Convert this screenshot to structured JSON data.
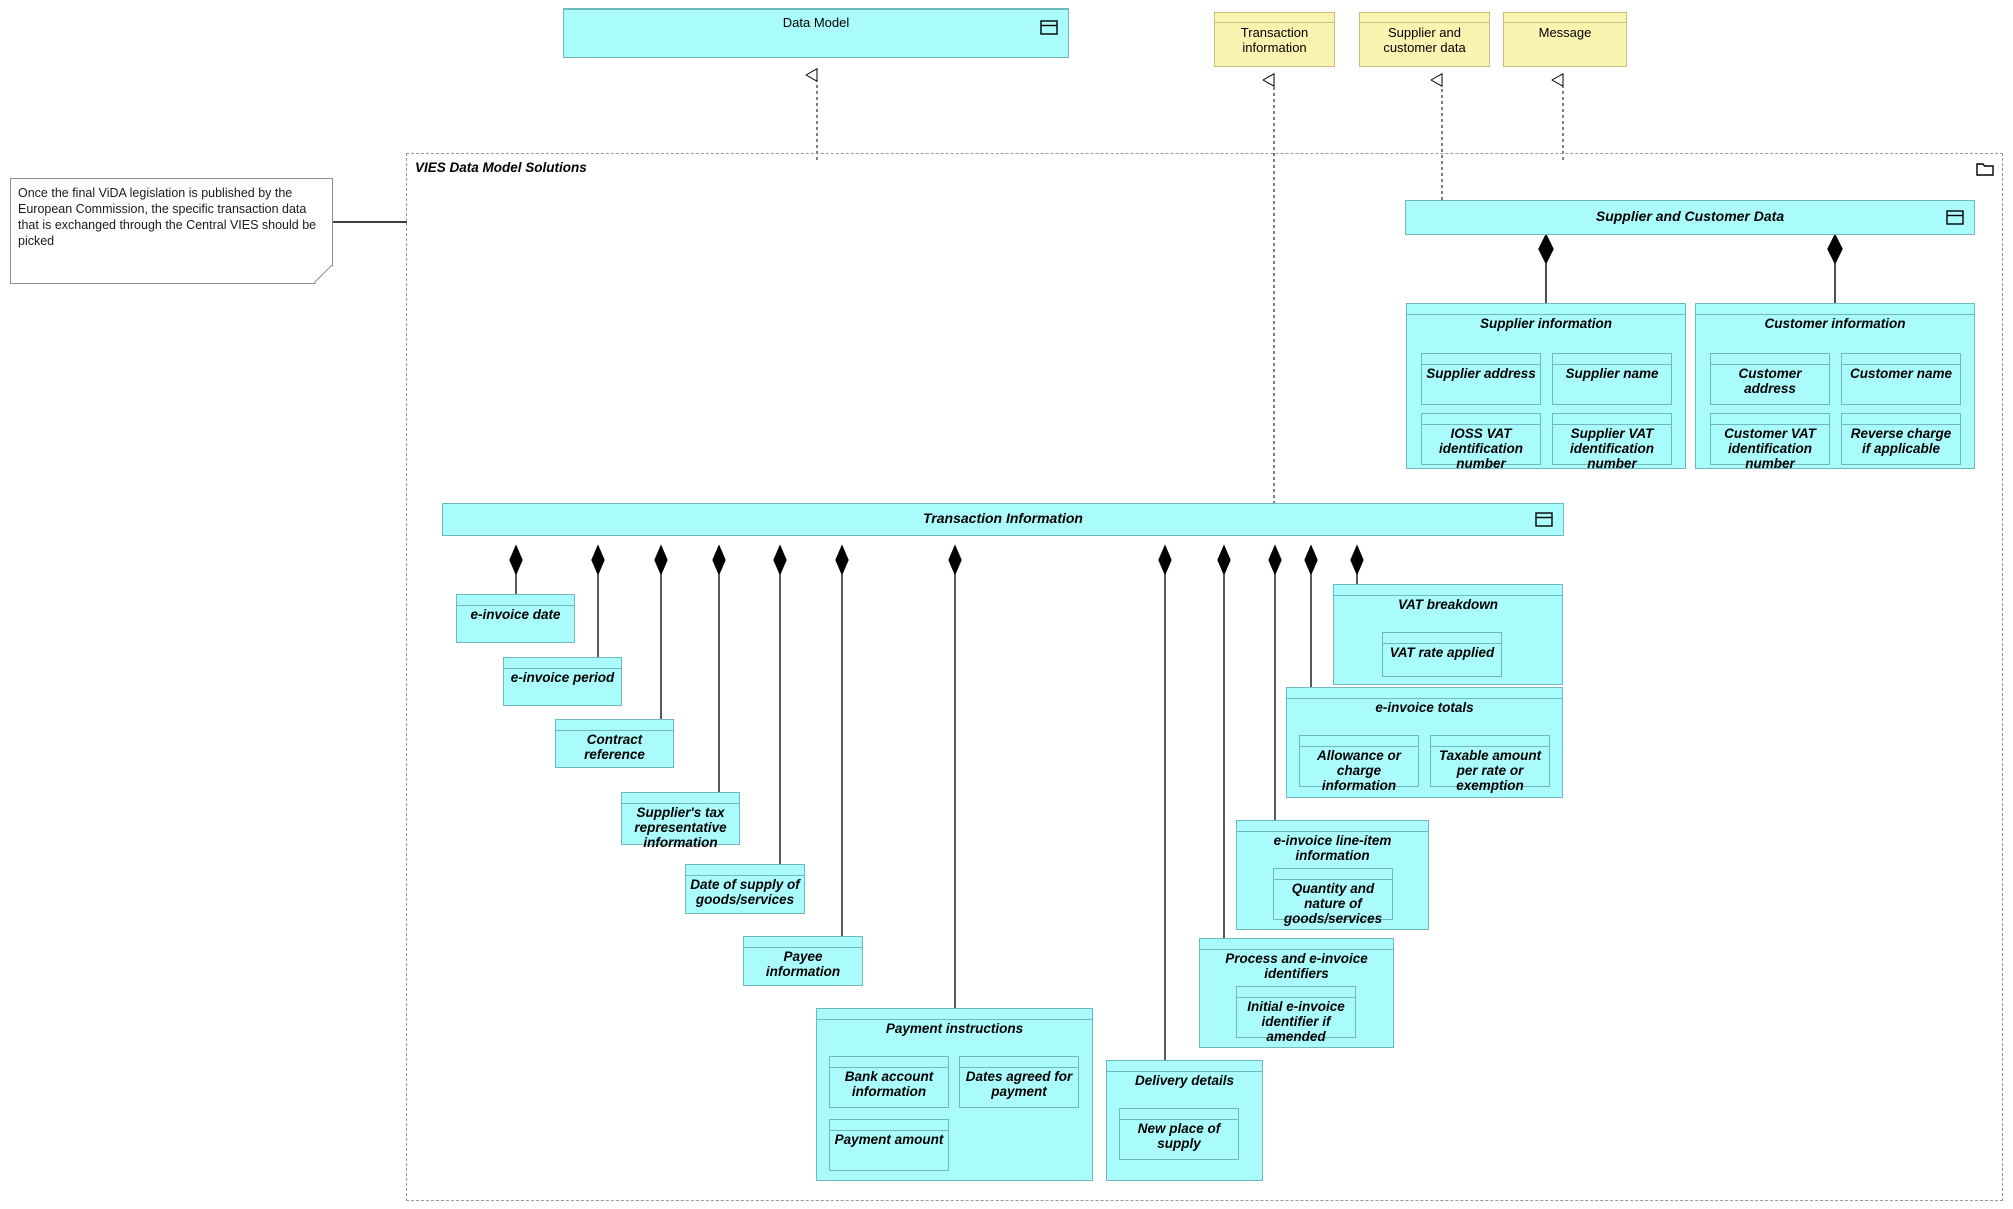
{
  "diagram": {
    "title": "VIES Data Model Solutions",
    "group_label": "VIES Data Model Solutions",
    "folder_icon": "folder-icon",
    "colors": {
      "data_object_fill": "#AAFCFC",
      "data_object_stroke": "#6FB8BD",
      "business_object_fill": "#FBF3B0",
      "business_object_stroke": "#C9BF80",
      "group_stroke": "#9A9A9A",
      "connector": "#000000",
      "note_fill": "#FFFFFF"
    }
  },
  "note": {
    "name": "vida-legislation-note",
    "text": "Once the final ViDA legislation is published by the European Commission, the specific transaction data that is exchanged through the Central VIES should be picked"
  },
  "top_level": {
    "data_model": {
      "label": "Data Model",
      "icon": "data-object-icon"
    },
    "concepts": [
      {
        "label": "Transaction information",
        "icon": "business-object-icon"
      },
      {
        "label": "Supplier and customer data",
        "icon": "business-object-icon"
      },
      {
        "label": "Message",
        "icon": "business-object-icon"
      }
    ]
  },
  "supplier_customer_data": {
    "label": "Supplier and Customer Data",
    "icon": "data-object-icon",
    "children": [
      {
        "label": "Supplier information",
        "attributes": [
          "Supplier address",
          "Supplier name",
          "IOSS VAT identification number",
          "Supplier VAT identification number"
        ]
      },
      {
        "label": "Customer information",
        "attributes": [
          "Customer address",
          "Customer name",
          "Customer VAT identification number",
          "Reverse charge if applicable"
        ]
      }
    ]
  },
  "transaction_information": {
    "label": "Transaction Information",
    "icon": "data-object-icon",
    "children": [
      {
        "label": "e-invoice date",
        "attributes": []
      },
      {
        "label": "e-invoice period",
        "attributes": []
      },
      {
        "label": "Contract reference",
        "attributes": []
      },
      {
        "label": "Supplier's tax representative information",
        "attributes": []
      },
      {
        "label": "Date of supply of goods/services",
        "attributes": []
      },
      {
        "label": "Payee information",
        "attributes": []
      },
      {
        "label": "Payment instructions",
        "attributes": [
          "Bank account information",
          "Dates agreed for payment",
          "Payment amount"
        ]
      },
      {
        "label": "Delivery details",
        "attributes": [
          "New place of supply"
        ]
      },
      {
        "label": "Process and e-invoice identifiers",
        "attributes": [
          "Initial e-invoice identifier if amended"
        ]
      },
      {
        "label": "e-invoice line-item information",
        "attributes": [
          "Quantity and nature of goods/services"
        ]
      },
      {
        "label": "e-invoice totals",
        "attributes": [
          "Allowance or charge information",
          "Taxable amount per rate or exemption"
        ]
      },
      {
        "label": "VAT breakdown",
        "attributes": [
          "VAT rate applied"
        ]
      }
    ]
  }
}
